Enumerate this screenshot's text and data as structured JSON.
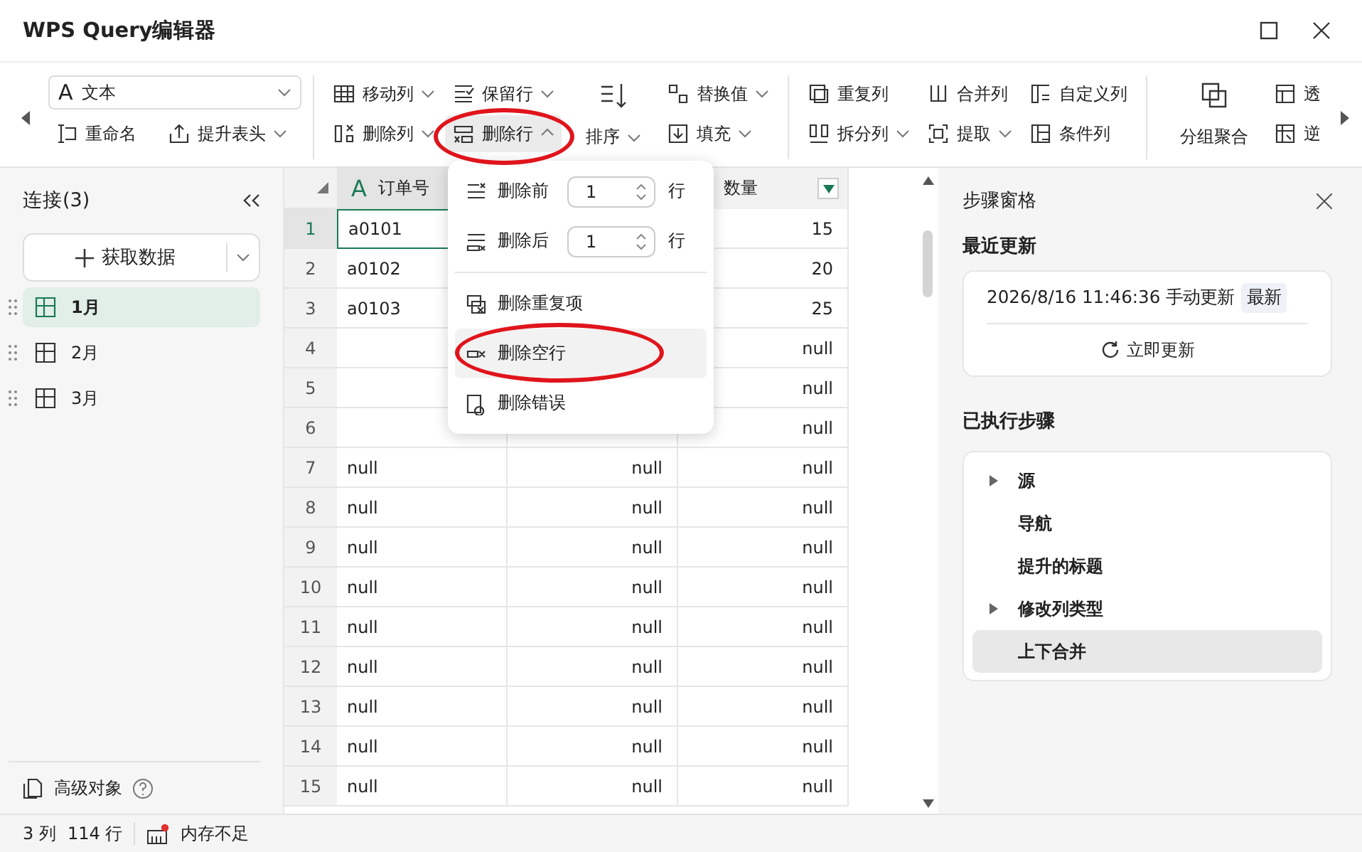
{
  "window": {
    "title": "WPS Query编辑器"
  },
  "ribbon": {
    "type_field": {
      "icon_text": "A",
      "value": "文本"
    },
    "header_buttons": [
      {
        "label": "重命名",
        "dropdown": false
      },
      {
        "label": "提升表头",
        "dropdown": true
      }
    ],
    "groups": [
      [
        [
          {
            "label": "移动列",
            "dropdown": true,
            "pressed": false
          },
          {
            "label": "删除列",
            "dropdown": true,
            "pressed": false
          }
        ],
        [
          {
            "label": "保留行",
            "dropdown": true,
            "pressed": false
          },
          {
            "label": "删除行",
            "dropdown": true,
            "open": true,
            "pressed": true
          }
        ],
        [
          {
            "label": "排序",
            "dropdown": true,
            "pressed": false,
            "kind": "large"
          }
        ],
        [
          {
            "label": "替换值",
            "dropdown": true,
            "pressed": false
          },
          {
            "label": "填充",
            "dropdown": true,
            "pressed": false
          }
        ]
      ],
      [
        [
          {
            "label": "重复列",
            "dropdown": false,
            "pressed": false
          },
          {
            "label": "拆分列",
            "dropdown": true,
            "pressed": false
          }
        ],
        [
          {
            "label": "合并列",
            "dropdown": false,
            "pressed": false
          },
          {
            "label": "提取",
            "dropdown": true,
            "pressed": false
          }
        ],
        [
          {
            "label": "自定义列",
            "dropdown": false,
            "pressed": false
          },
          {
            "label": "条件列",
            "dropdown": false,
            "pressed": false
          }
        ]
      ],
      [
        [
          {
            "label": "分组聚合",
            "dropdown": false,
            "pressed": false,
            "kind": "large"
          }
        ],
        [
          {
            "label": "透",
            "dropdown": false,
            "pressed": false
          },
          {
            "label": "逆",
            "dropdown": false,
            "pressed": false
          }
        ]
      ]
    ]
  },
  "sidebar": {
    "title": "连接(3)",
    "get_data": "获取数据",
    "queries": [
      {
        "label": "1月",
        "selected": true
      },
      {
        "label": "2月",
        "selected": false
      },
      {
        "label": "3月",
        "selected": false
      }
    ],
    "footer": "高级对象"
  },
  "table": {
    "columns": [
      {
        "name": "订单号",
        "type_label": "A",
        "selected": true
      },
      null,
      {
        "name": "数量",
        "selected": false,
        "filter": true
      }
    ],
    "rows": [
      {
        "index": "1",
        "selected": true,
        "cells": [
          "a0101",
          null,
          "15"
        ]
      },
      {
        "index": "2",
        "selected": false,
        "cells": [
          "a0102",
          null,
          "20"
        ]
      },
      {
        "index": "3",
        "selected": false,
        "cells": [
          "a0103",
          null,
          "25"
        ]
      },
      {
        "index": "4",
        "selected": false,
        "cells": [
          null,
          null,
          "null"
        ]
      },
      {
        "index": "5",
        "selected": false,
        "cells": [
          null,
          null,
          "null"
        ]
      },
      {
        "index": "6",
        "selected": false,
        "cells": [
          null,
          null,
          "null"
        ]
      },
      {
        "index": "7",
        "selected": false,
        "cells": [
          "null",
          "null",
          "null"
        ]
      },
      {
        "index": "8",
        "selected": false,
        "cells": [
          "null",
          "null",
          "null"
        ]
      },
      {
        "index": "9",
        "selected": false,
        "cells": [
          "null",
          "null",
          "null"
        ]
      },
      {
        "index": "10",
        "selected": false,
        "cells": [
          "null",
          "null",
          "null"
        ]
      },
      {
        "index": "11",
        "selected": false,
        "cells": [
          "null",
          "null",
          "null"
        ]
      },
      {
        "index": "12",
        "selected": false,
        "cells": [
          "null",
          "null",
          "null"
        ]
      },
      {
        "index": "13",
        "selected": false,
        "cells": [
          "null",
          "null",
          "null"
        ]
      },
      {
        "index": "14",
        "selected": false,
        "cells": [
          "null",
          "null",
          "null"
        ]
      },
      {
        "index": "15",
        "selected": false,
        "cells": [
          "null",
          "null",
          "null"
        ]
      }
    ]
  },
  "menu": {
    "items": [
      {
        "kind": "count",
        "label": "删除前",
        "value": "1",
        "unit": "行",
        "highlighted": false
      },
      {
        "kind": "count",
        "label": "删除后",
        "value": "1",
        "unit": "行",
        "highlighted": false
      },
      {
        "kind": "action",
        "label": "删除重复项",
        "highlighted": false
      },
      {
        "kind": "action",
        "label": "删除空行",
        "highlighted": true
      },
      {
        "kind": "action",
        "label": "删除错误",
        "highlighted": false
      }
    ]
  },
  "steps_pane": {
    "title": "步骤窗格",
    "recent_title": "最近更新",
    "recent_text": "2026/8/16 11:46:36 手动更新",
    "recent_badge": "最新",
    "refresh_button": "立即更新",
    "steps_title": "已执行步骤",
    "steps": [
      {
        "label": "源",
        "expandable": true,
        "selected": false
      },
      {
        "label": "导航",
        "expandable": false,
        "selected": false
      },
      {
        "label": "提升的标题",
        "expandable": false,
        "selected": false
      },
      {
        "label": "修改列类型",
        "expandable": true,
        "selected": false
      },
      {
        "label": "上下合并",
        "expandable": false,
        "selected": true
      }
    ]
  },
  "status_bar": {
    "columns": "3 列",
    "rows": "114 行",
    "memory": "内存不足"
  }
}
